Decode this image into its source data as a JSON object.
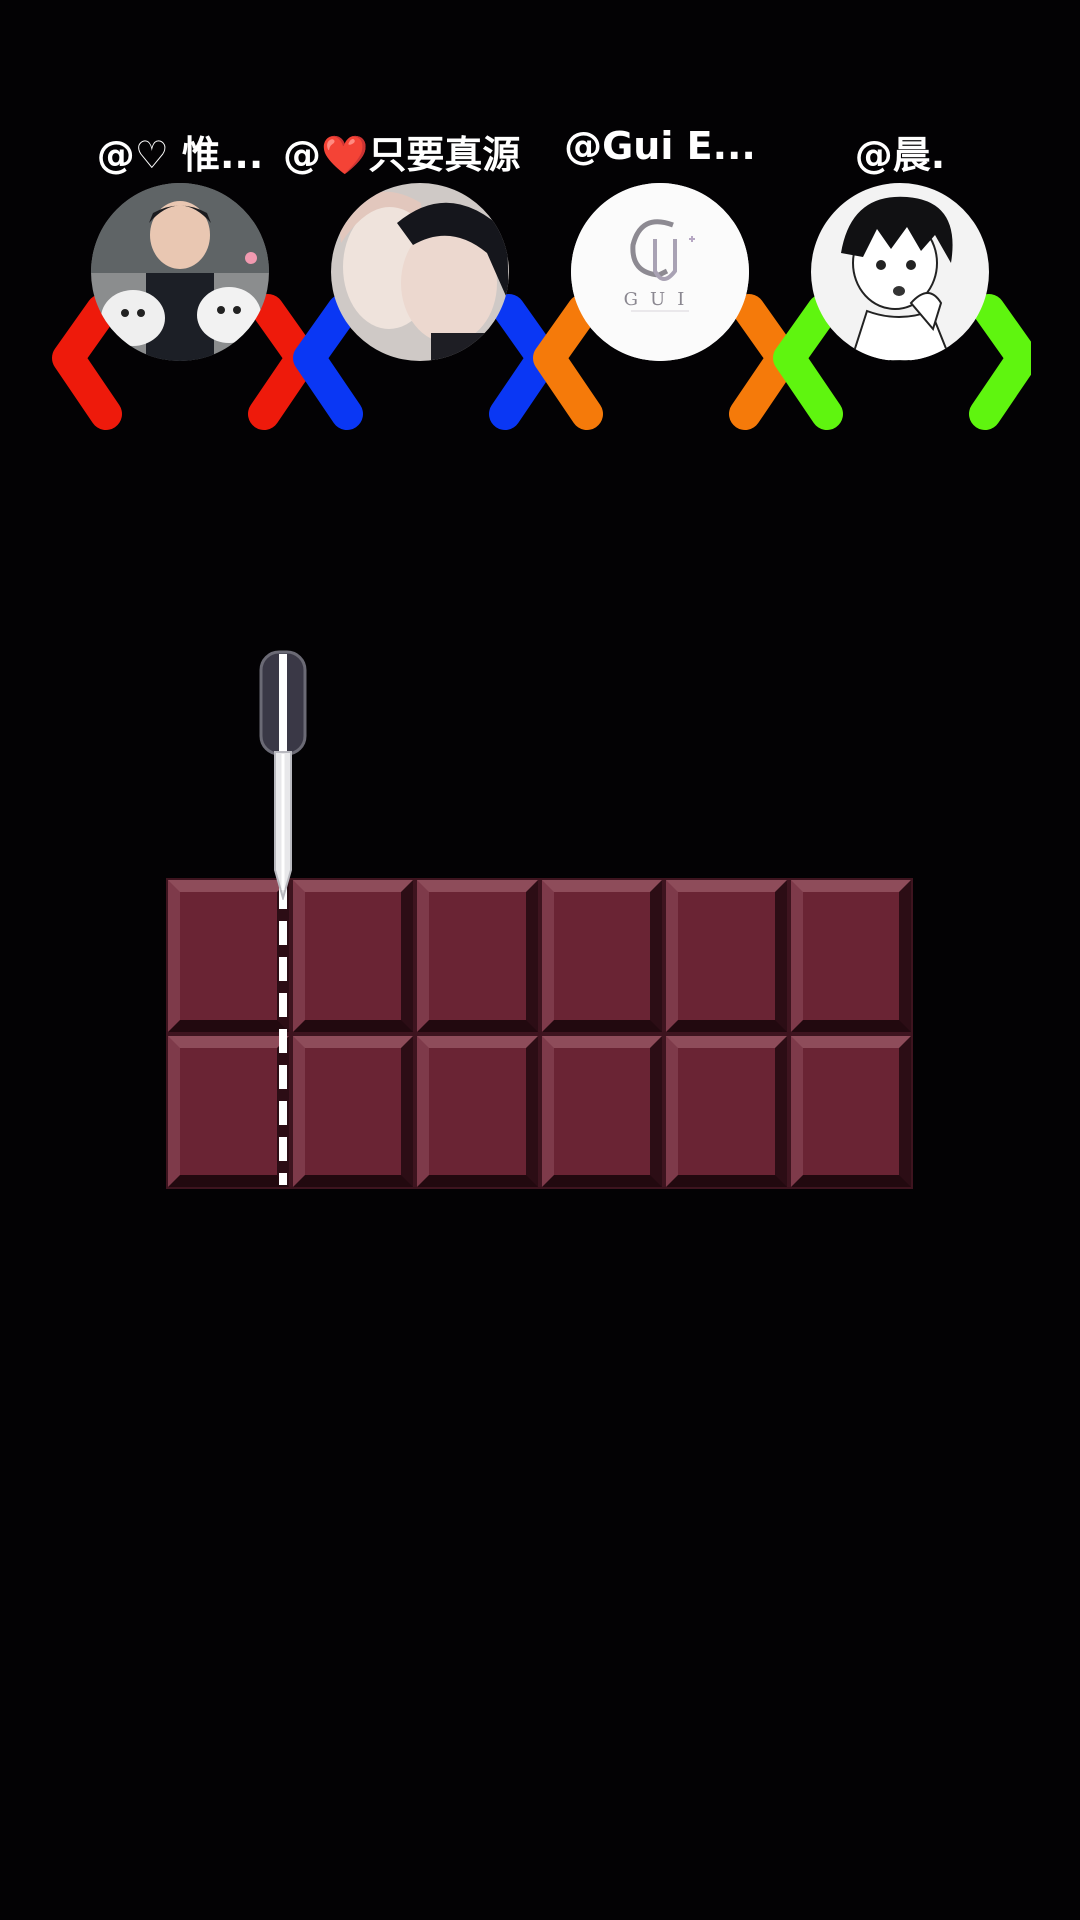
{
  "players": [
    {
      "handle": "@♡ 惟...",
      "claw_color": "#ee1a0b",
      "avatar": "selfie-with-cats-photo"
    },
    {
      "handle": "@❤️只要真源...",
      "claw_color": "#0a37f4",
      "avatar": "couple-photo"
    },
    {
      "handle": "@Gui E...",
      "claw_color": "#f57a0a",
      "avatar": "gui-logo",
      "logo_text": "GUI"
    },
    {
      "handle": "@晨.",
      "claw_color": "#5ff50f",
      "avatar": "anime-boy-drawing"
    }
  ],
  "chocolate": {
    "rows": 2,
    "columns": 6,
    "pieces_remaining": 12,
    "cut_after_column": 1
  },
  "colors": {
    "background": "#030204",
    "chocolate": "#6a2434",
    "knife_handle": "#3a3846",
    "cut_guide": "#ffffff"
  }
}
